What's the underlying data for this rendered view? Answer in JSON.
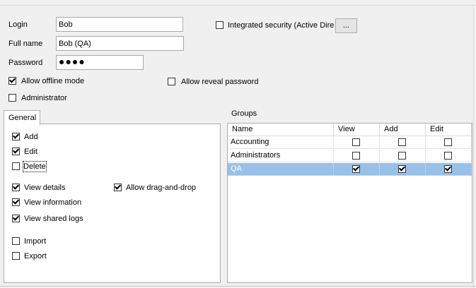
{
  "form": {
    "login_label": "Login",
    "login_value": "Bob",
    "fullname_label": "Full name",
    "fullname_value": "Bob (QA)",
    "password_label": "Password",
    "password_value": "●●●●",
    "integrated_security_label": "Integrated security (Active Dire",
    "integrated_security_checked": false,
    "browse_button_label": "...",
    "allow_offline_label": "Allow offline mode",
    "allow_offline_checked": true,
    "allow_reveal_label": "Allow reveal password",
    "allow_reveal_checked": false,
    "administrator_label": "Administrator",
    "administrator_checked": false
  },
  "general": {
    "tab_label": "General",
    "items": [
      {
        "label": "Add",
        "checked": true
      },
      {
        "label": "Edit",
        "checked": true
      },
      {
        "label": "Delete",
        "checked": false
      },
      {
        "label": "View details",
        "checked": true
      },
      {
        "label": "View information",
        "checked": true
      },
      {
        "label": "View shared logs",
        "checked": true
      },
      {
        "label": "Import",
        "checked": false
      },
      {
        "label": "Export",
        "checked": false
      },
      {
        "label": "Allow drag-and-drop",
        "checked": true
      }
    ]
  },
  "groups": {
    "title": "Groups",
    "columns": [
      "Name",
      "View",
      "Add",
      "Edit"
    ],
    "rows": [
      {
        "name": "Accounting",
        "view": false,
        "add": false,
        "edit": false,
        "selected": false
      },
      {
        "name": "Administrators",
        "view": false,
        "add": false,
        "edit": false,
        "selected": false
      },
      {
        "name": "QA",
        "view": true,
        "add": true,
        "edit": true,
        "selected": true
      }
    ]
  },
  "colors": {
    "selection": "#99c1e8",
    "background": "#f0f0f0"
  }
}
